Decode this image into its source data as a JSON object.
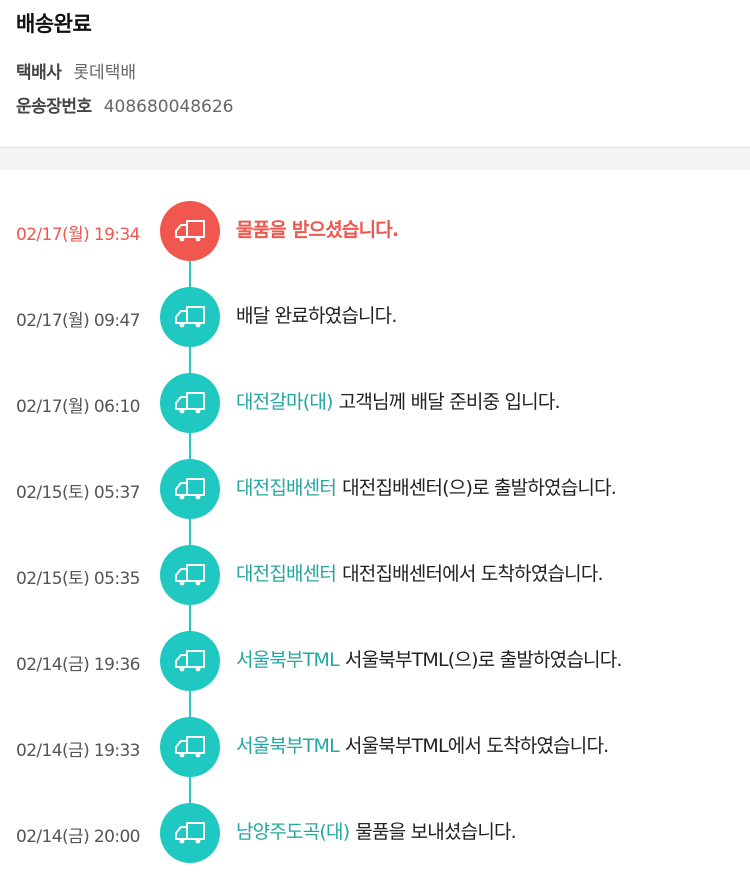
{
  "header": {
    "status_title": "배송완료",
    "courier_label": "택배사",
    "courier_value": "롯데택배",
    "tracking_label": "운송장번호",
    "tracking_value": "408680048626"
  },
  "colors": {
    "current": "#f1564f",
    "node": "#1fc9c1",
    "location": "#25a7a1",
    "line": "#2cc6c0"
  },
  "timeline": {
    "icon": "delivery-truck-icon",
    "events": [
      {
        "time": "02/17(월) 19:34",
        "location": "",
        "message": "물품을 받으셨습니다."
      },
      {
        "time": "02/17(월) 09:47",
        "location": "",
        "message": "배달 완료하였습니다."
      },
      {
        "time": "02/17(월) 06:10",
        "location": "대전갈마(대)",
        "message": "고객님께 배달 준비중 입니다."
      },
      {
        "time": "02/15(토) 05:37",
        "location": "대전집배센터",
        "message": "대전집배센터(으)로 출발하였습니다."
      },
      {
        "time": "02/15(토) 05:35",
        "location": "대전집배센터",
        "message": "대전집배센터에서 도착하였습니다."
      },
      {
        "time": "02/14(금) 19:36",
        "location": "서울북부TML",
        "message": "서울북부TML(으)로 출발하였습니다."
      },
      {
        "time": "02/14(금) 19:33",
        "location": "서울북부TML",
        "message": "서울북부TML에서 도착하였습니다."
      },
      {
        "time": "02/14(금) 20:00",
        "location": "남양주도곡(대)",
        "message": "물품을 보내셨습니다."
      }
    ]
  }
}
